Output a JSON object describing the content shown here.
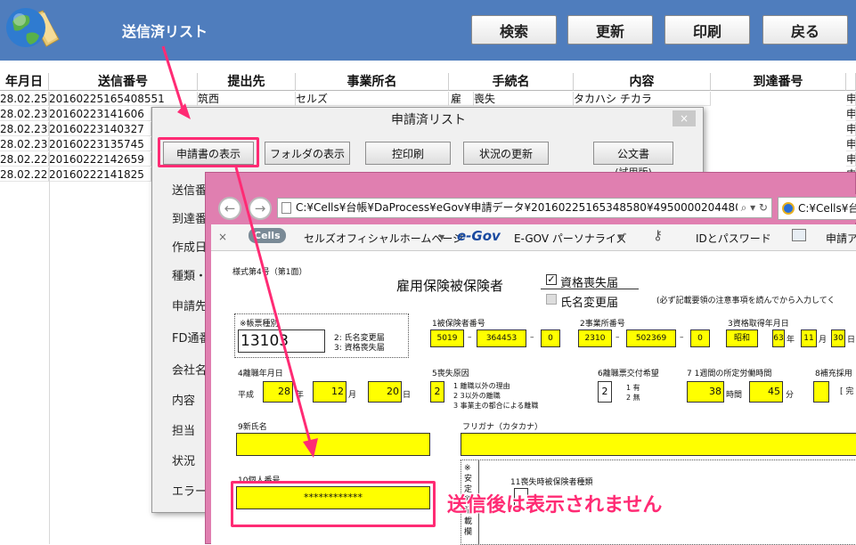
{
  "header": {
    "title": "送信済リスト",
    "buttons": {
      "search": "検索",
      "refresh": "更新",
      "print": "印刷",
      "back": "戻る"
    },
    "bg_color": "#4f7dbd"
  },
  "grid": {
    "columns": [
      "年月日",
      "送信番号",
      "提出先",
      "事業所名",
      "手続名",
      "内容",
      "到達番号"
    ],
    "rows": [
      {
        "date": "28.02.25",
        "number": "20160225165408551",
        "office": "筑西",
        "company": "セルズ",
        "proc_prefix": "雇",
        "proc": "喪失",
        "content": "タカハシ チカラ",
        "right": "申"
      },
      {
        "date": "28.02.23",
        "number": "20160223141606",
        "right": "申"
      },
      {
        "date": "28.02.23",
        "number": "20160223140327",
        "right": "申"
      },
      {
        "date": "28.02.23",
        "number": "20160223135745",
        "right": "申"
      },
      {
        "date": "28.02.22",
        "number": "20160222142659",
        "right": "申"
      },
      {
        "date": "28.02.22",
        "number": "20160222141825",
        "right": "申"
      }
    ]
  },
  "dialog": {
    "title": "申請済リスト",
    "close": "×",
    "buttons": [
      "申請書の表示",
      "フォルダの表示",
      "控印刷",
      "状況の更新",
      "公文書"
    ],
    "kosho_note": "(試用版)",
    "labels": [
      "送信番",
      "到達番",
      "作成日",
      "種類・",
      "申請先",
      "FD通番",
      "会社名",
      "内容",
      "担当",
      "状況",
      "エラー"
    ]
  },
  "browser": {
    "address": "C:¥Cells¥台帳¥DaProcess¥eGov¥申請データ¥20160225165348580¥49500002044802",
    "address_icons": "⌕ ▾ ↻",
    "second_tab": "C:¥Cells¥台",
    "favorites": [
      "Cells",
      "セルズオフィシャルホームページ",
      "e-Gov",
      "E-GOV パーソナライズ",
      "IDとパスワード",
      "申請ア"
    ],
    "fav_close": "×"
  },
  "form": {
    "form_no": "様式第4号（第1面）",
    "title": "雇用保険被保険者",
    "check1": "資格喪失届",
    "check2": "氏名変更届",
    "note": "(必ず記載要領の注意事項を読んでから入力してく",
    "kind_label": "※帳票種別",
    "kind_value": "13103",
    "kind_opt1": "2: 氏名変更届",
    "kind_opt2": "3: 資格喪失届",
    "f1_label": "1被保険者番号",
    "f1": [
      "5019",
      "364453",
      "0"
    ],
    "f2_label": "2事業所番号",
    "f2": [
      "2310",
      "502369",
      "0"
    ],
    "f3_label": "3資格取得年月日",
    "f3": [
      "昭和",
      "63",
      "11",
      "30"
    ],
    "f3_units": [
      "年",
      "月",
      "日"
    ],
    "f4_label": "4離職年月日",
    "f4_era": "平成",
    "f4": [
      "28",
      "12",
      "20"
    ],
    "f4_units": [
      "年",
      "月",
      "日"
    ],
    "f5_label": "5喪失原因",
    "f5": "2",
    "f5_opts": [
      "1 離職以外の理由",
      "2 3以外の離職",
      "3 事業主の都合による離職"
    ],
    "f6_label": "6離職票交付希望",
    "f6": "2",
    "f6_opts": [
      "1 有",
      "2 無"
    ],
    "f7_label": "7 1週間の所定労働時間",
    "f7": [
      "38",
      "45"
    ],
    "f7_units": [
      "時間",
      "分"
    ],
    "f8_label": "8補充採用",
    "f8_extra": "[ 完",
    "f9_label": "9新氏名",
    "furigana_label": "フリガナ（カタカナ）",
    "f10_label": "10個人番号",
    "f10": "************",
    "f11_label": "11喪失時被保険者種類",
    "side_label": "※ 安 定 所 記 載 欄"
  },
  "annotation": {
    "caption": "送信後は表示されません",
    "color": "#ff2b74"
  }
}
